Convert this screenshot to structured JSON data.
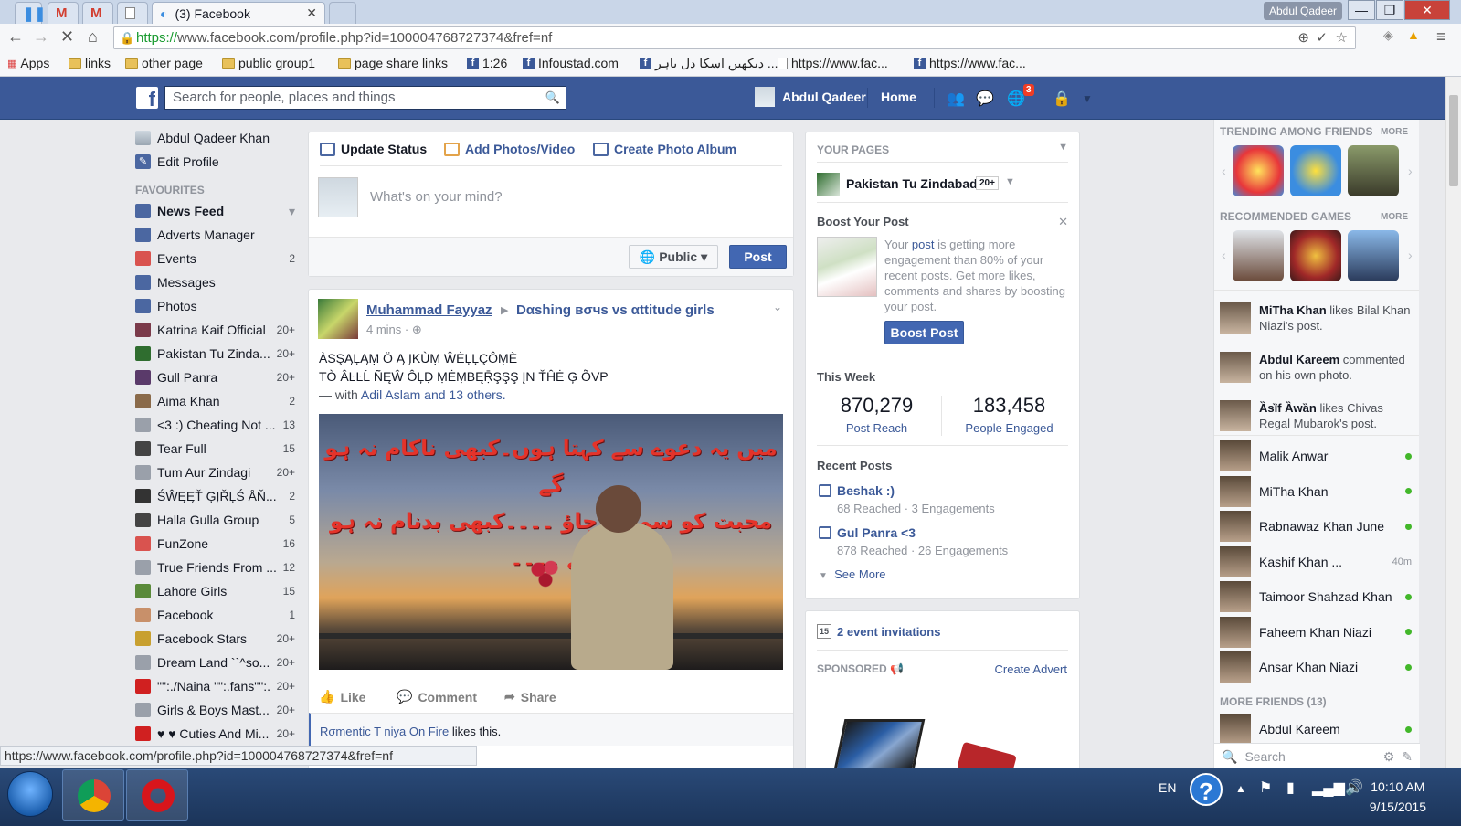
{
  "browser": {
    "active_tab_title": "(3) Facebook",
    "user_badge": "Abdul Qadeer",
    "url_scheme": "https://",
    "url_rest": "www.facebook.com/profile.php?id=100004768727374&fref=nf",
    "bookmarks": [
      "Apps",
      "links",
      "other page",
      "public group1",
      "page share links",
      "1:26",
      "Infoustad.com",
      "دیکھیں اسکا دل باہر ...",
      "https://www.fac...",
      "https://www.fac..."
    ],
    "status_url": "https://www.facebook.com/profile.php?id=100004768727374&fref=nf"
  },
  "fb_header": {
    "search_placeholder": "Search for people, places and things",
    "user_name": "Abdul Qadeer",
    "home": "Home",
    "notifications_count": "3"
  },
  "left": {
    "profile_name": "Abdul Qadeer Khan",
    "edit_profile": "Edit Profile",
    "favourites_header": "FAVOURITES",
    "items": [
      {
        "label": "News Feed",
        "count": "",
        "color": "#4b67a1"
      },
      {
        "label": "Adverts Manager",
        "count": "",
        "color": "#4b67a1"
      },
      {
        "label": "Events",
        "count": "2",
        "color": "#d9534f"
      },
      {
        "label": "Messages",
        "count": "",
        "color": "#4b67a1"
      },
      {
        "label": "Photos",
        "count": "",
        "color": "#4b67a1"
      },
      {
        "label": "Katrina Kaif Official",
        "count": "20+",
        "color": "#7a3a4a"
      },
      {
        "label": "Pakistan Tu Zinda...",
        "count": "20+",
        "color": "#2f6d2f"
      },
      {
        "label": "Gull Panra",
        "count": "20+",
        "color": "#5a3a6a"
      },
      {
        "label": "Aima Khan",
        "count": "2",
        "color": "#8a6a4a"
      },
      {
        "label": "<3 :) Cheating Not ...",
        "count": "13",
        "color": "#9aa0aa"
      },
      {
        "label": "Tear Full",
        "count": "15",
        "color": "#444444"
      },
      {
        "label": "Tum Aur Zindagi",
        "count": "20+",
        "color": "#9aa0aa"
      },
      {
        "label": "ŚŴĘĘŤ ĢĮŘĻŚ ÅŇ...",
        "count": "2",
        "color": "#333333"
      },
      {
        "label": "Halla Gulla Group",
        "count": "5",
        "color": "#444444"
      },
      {
        "label": "FunZone",
        "count": "16",
        "color": "#d9534f"
      },
      {
        "label": "True Friends From ...",
        "count": "12",
        "color": "#9aa0aa"
      },
      {
        "label": "Lahore Girls",
        "count": "15",
        "color": "#5a8a3a"
      },
      {
        "label": "Facebook",
        "count": "1",
        "color": "#c8906a"
      },
      {
        "label": "Facebook Stars",
        "count": "20+",
        "color": "#c8a030"
      },
      {
        "label": "Dream Land ``^so...",
        "count": "20+",
        "color": "#9aa0aa"
      },
      {
        "label": "\"\":./Naina \"\":.fans\"\":.",
        "count": "20+",
        "color": "#d02020"
      },
      {
        "label": "Girls & Boys Mast...",
        "count": "20+",
        "color": "#9aa0aa"
      },
      {
        "label": "♥ ♥ Cuties And Mi...",
        "count": "20+",
        "color": "#d02020"
      }
    ]
  },
  "composer": {
    "tab_status": "Update Status",
    "tab_photos": "Add Photos/Video",
    "tab_album": "Create Photo Album",
    "placeholder": "What's on your mind?",
    "privacy": "Public",
    "post": "Post"
  },
  "post": {
    "author": "Muhammad Fayyaz",
    "group": "Dαshing вσчs vs αttitude girls",
    "time": "4 mins",
    "line1": "ÀSŞĄĻĄṂ Ö Ą  ĮKÙṂ ŴĖĻĻÇÔṂÈ",
    "line2": "TÒ ÂĿĿĹ ÑĘŴ ÔĻḌ ṂĖṂBĘṜŞŞŞ ĮN ŤĤĖ Ģ  ÕVP",
    "with_prefix": "— with",
    "with_names": "Adil Aslam and 13 others.",
    "image_text_line1": "میں یہ دعوے سے کہتا ہوں۔کبھی ناکام نہ ہو گے",
    "image_text_line2": "محبت کو سمجھ جاؤ ۔۔۔۔کبھی بدنام نہ ہو گے ۔۔۔۔",
    "like": "Like",
    "comment": "Comment",
    "share": "Share",
    "liker": "Rσmentic T  niya On Fire",
    "likes_suffix": "likes this."
  },
  "pages": {
    "header": "YOUR PAGES",
    "page_name": "Pakistan Tu Zindabad",
    "page_badge": "20+",
    "boost_header": "Boost Your Post",
    "boost_text_before": "Your",
    "boost_text_link": "post",
    "boost_text_after": "is getting more engagement than 80% of your recent posts. Get more likes, comments and shares by boosting your post.",
    "boost_btn": "Boost Post",
    "this_week": "This Week",
    "reach_value": "870,279",
    "reach_label": "Post Reach",
    "engaged_value": "183,458",
    "engaged_label": "People Engaged",
    "recent_header": "Recent Posts",
    "recent": [
      {
        "title": "Beshak :)",
        "stats": "68 Reached · 3 Engagements"
      },
      {
        "title": "Gul Panra <3",
        "stats": "878 Reached · 26 Engagements"
      }
    ],
    "see_more": "See More"
  },
  "events": {
    "invites": "2 event invitations",
    "sponsored": "SPONSORED",
    "create_advert": "Create Advert"
  },
  "sidebar": {
    "trending_header": "TRENDING AMONG FRIENDS",
    "more": "MORE",
    "games_header": "RECOMMENDED GAMES",
    "ticker": [
      {
        "name": "MiTha Khan",
        "text": "likes Bilal Khan Niazi's post."
      },
      {
        "name": "Abdul Kareem",
        "text": "commented on his own photo."
      },
      {
        "name": "Ȁsȉf Ȁwȁn",
        "text": "likes Chivas Regal Mubarok's post."
      }
    ],
    "friends": [
      {
        "name": "Malik Anwar",
        "status": ""
      },
      {
        "name": "MiTha Khan",
        "status": ""
      },
      {
        "name": "Rabnawaz Khan June",
        "status": ""
      },
      {
        "name": "Kashif Khan ...",
        "status": "40m"
      },
      {
        "name": "Taimoor Shahzad Khan",
        "status": ""
      },
      {
        "name": "Faheem Khan Niazi",
        "status": ""
      },
      {
        "name": "Ansar Khan Niazi",
        "status": ""
      }
    ],
    "more_friends": "MORE FRIENDS (13)",
    "more_friend_1": "Abdul Kareem",
    "search": "Search"
  },
  "taskbar": {
    "lang": "EN",
    "time": "10:10 AM",
    "date": "9/15/2015"
  }
}
